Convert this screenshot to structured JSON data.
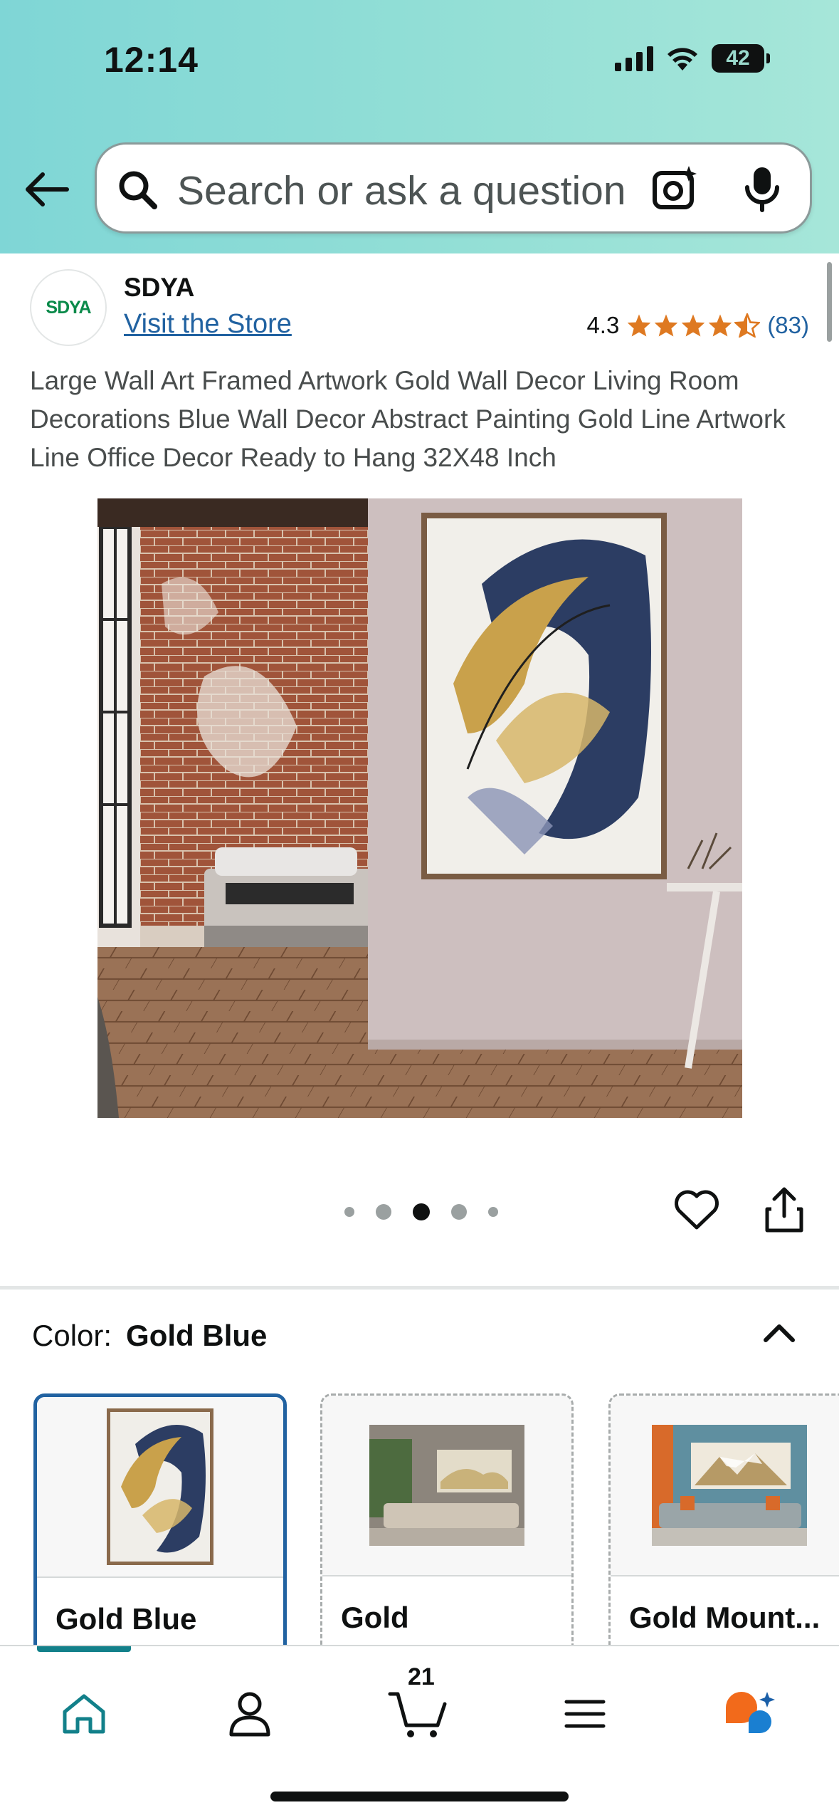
{
  "status_bar": {
    "time": "12:14",
    "battery": "42"
  },
  "search": {
    "placeholder": "Search or ask a question"
  },
  "store": {
    "name": "SDYA",
    "logo_text": "SDYA",
    "link": "Visit the Store"
  },
  "rating": {
    "value": "4.3",
    "count": "(83)",
    "stars": 4.3
  },
  "product": {
    "title": "Large Wall Art Framed Artwork Gold Wall Decor Living Room Decorations Blue Wall Decor Abstract Painting Gold Line Artwork Line Office Decor Ready to Hang 32X48 Inch",
    "image_count": 5,
    "current_image": 3
  },
  "color": {
    "label": "Color:",
    "selected": "Gold Blue",
    "options": [
      {
        "label": "Gold Blue",
        "selected": true
      },
      {
        "label": "Gold",
        "selected": false
      },
      {
        "label": "Gold Mount...",
        "selected": false
      }
    ]
  },
  "nav": {
    "items": [
      "home-icon",
      "account-icon",
      "cart-icon",
      "menu-icon",
      "rufus-icon"
    ],
    "cart_count": "21"
  },
  "colors": {
    "accent": "#12808a",
    "link": "#2162a1",
    "star": "#de7921"
  }
}
